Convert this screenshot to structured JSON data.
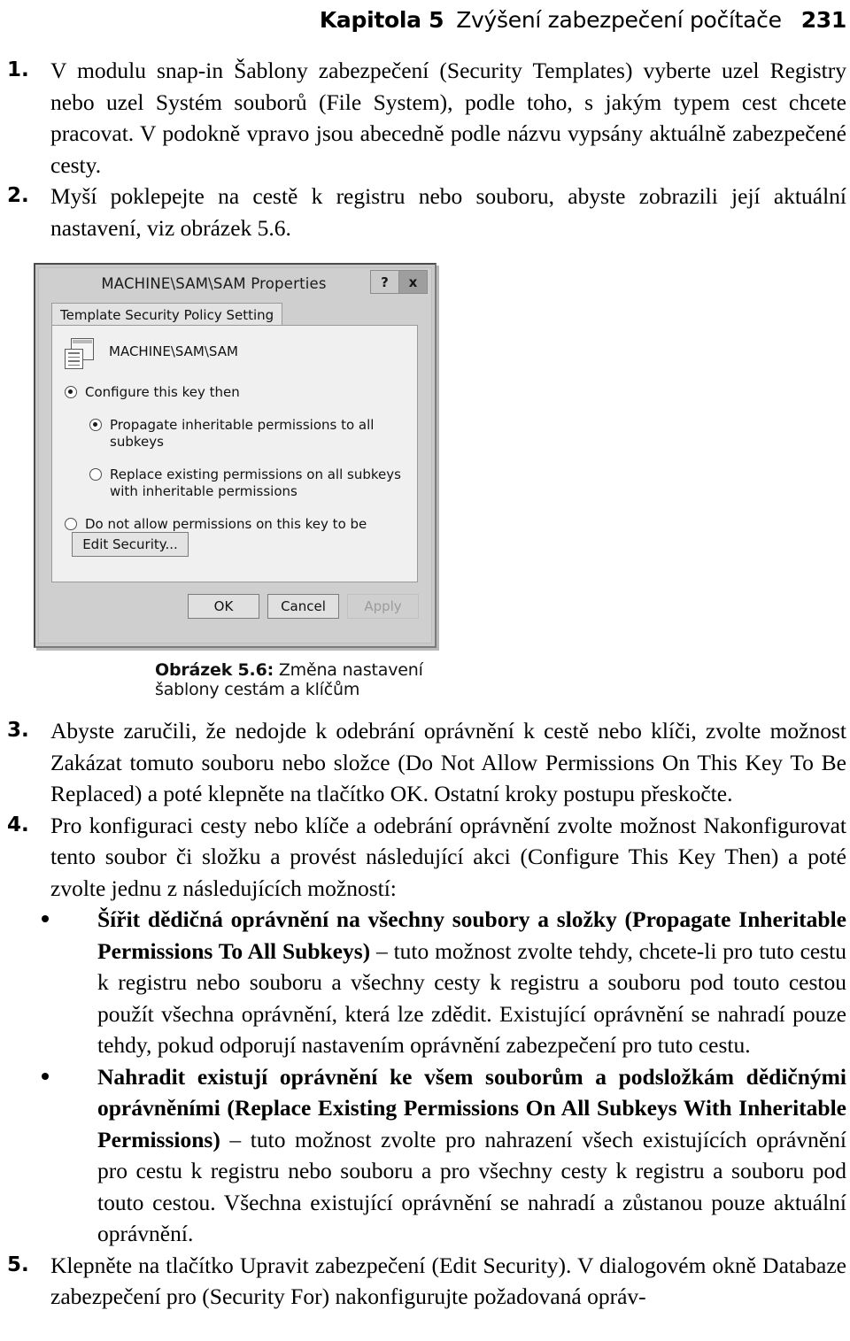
{
  "running_head": {
    "chapter": "Kapitola 5",
    "title": "Zvýšení zabezpečení počítače",
    "page": "231"
  },
  "steps": [
    {
      "number": "1.",
      "text": "V modulu snap-in Šablony zabezpečení (Security Templates) vyberte uzel Registry nebo uzel Systém souborů (File System), podle toho, s jakým typem cest chcete pracovat. V podokně vpravo jsou abecedně podle názvu vypsány aktuálně zabezpečené cesty."
    },
    {
      "number": "2.",
      "text": "Myší poklepejte na cestě k registru nebo souboru, abyste zobrazili její aktuální nastavení, viz obrázek 5.6."
    },
    {
      "number": "3.",
      "text": "Abyste zaručili, že nedojde k odebrání oprávnění k cestě nebo klíči, zvolte možnost Zakázat tomuto souboru nebo složce (Do Not Allow Permissions On This Key To Be Replaced) a poté klepněte na tlačítko OK. Ostatní kroky postupu přeskočte."
    },
    {
      "number": "4.",
      "text": "Pro konfiguraci cesty nebo klíče a odebrání oprávnění zvolte možnost Nakonfigurovat tento soubor či složku a provést následující akci (Configure This Key Then) a poté zvolte jednu z následujících možností:"
    },
    {
      "number": "5.",
      "text": "Klepněte na tlačítko Upravit zabezpečení (Edit Security). V dialogovém okně Databaze zabezpečení pro (Security For) nakonfigurujte požadovaná opráv-"
    }
  ],
  "bullets": [
    {
      "bold_part": "Šířit dědičná oprávnění na všechny soubory a složky (Propagate Inheritable Permissions To All Subkeys)",
      "rest": " – tuto možnost zvolte tehdy, chcete-li pro tuto cestu k registru nebo souboru a všechny cesty k registru a souboru pod touto cestou použít všechna oprávnění, která lze zdědit. Existující oprávnění se nahradí pouze tehdy, pokud odporují nastavením oprávnění zabezpečení pro tuto cestu."
    },
    {
      "bold_part": "Nahradit existují oprávnění ke všem souborům a podsložkám dědičnými oprávněními (Replace Existing Permissions On All Subkeys With Inheritable Permissions)",
      "rest": " – tuto možnost zvolte pro nahrazení všech existujících oprávnění pro cestu k registru nebo souboru a pro všechny cesty k registru a souboru pod touto cestou. Všechna existující oprávnění se nahradí a zůstanou pouze aktuální oprávnění."
    }
  ],
  "figure": {
    "caption_label": "Obrázek 5.6:",
    "caption_text": " Změna nastavení šablony cestám a klíčům",
    "dialog": {
      "title": "MACHINE\\SAM\\SAM Properties",
      "help_button": "?",
      "close_button": "x",
      "tab_label": "Template Security Policy Setting",
      "resource_name": "MACHINE\\SAM\\SAM",
      "options": [
        {
          "label": "Configure this key then",
          "checked": true,
          "indent": false
        },
        {
          "label": "Propagate inheritable permissions to all subkeys",
          "checked": true,
          "indent": true
        },
        {
          "label": "Replace existing permissions on all subkeys with inheritable permissions",
          "checked": false,
          "indent": true
        },
        {
          "label": "Do not allow permissions on this key to be replaced",
          "checked": false,
          "indent": false
        }
      ],
      "edit_security_label": "Edit Security...",
      "ok_label": "OK",
      "cancel_label": "Cancel",
      "apply_label": "Apply"
    }
  }
}
